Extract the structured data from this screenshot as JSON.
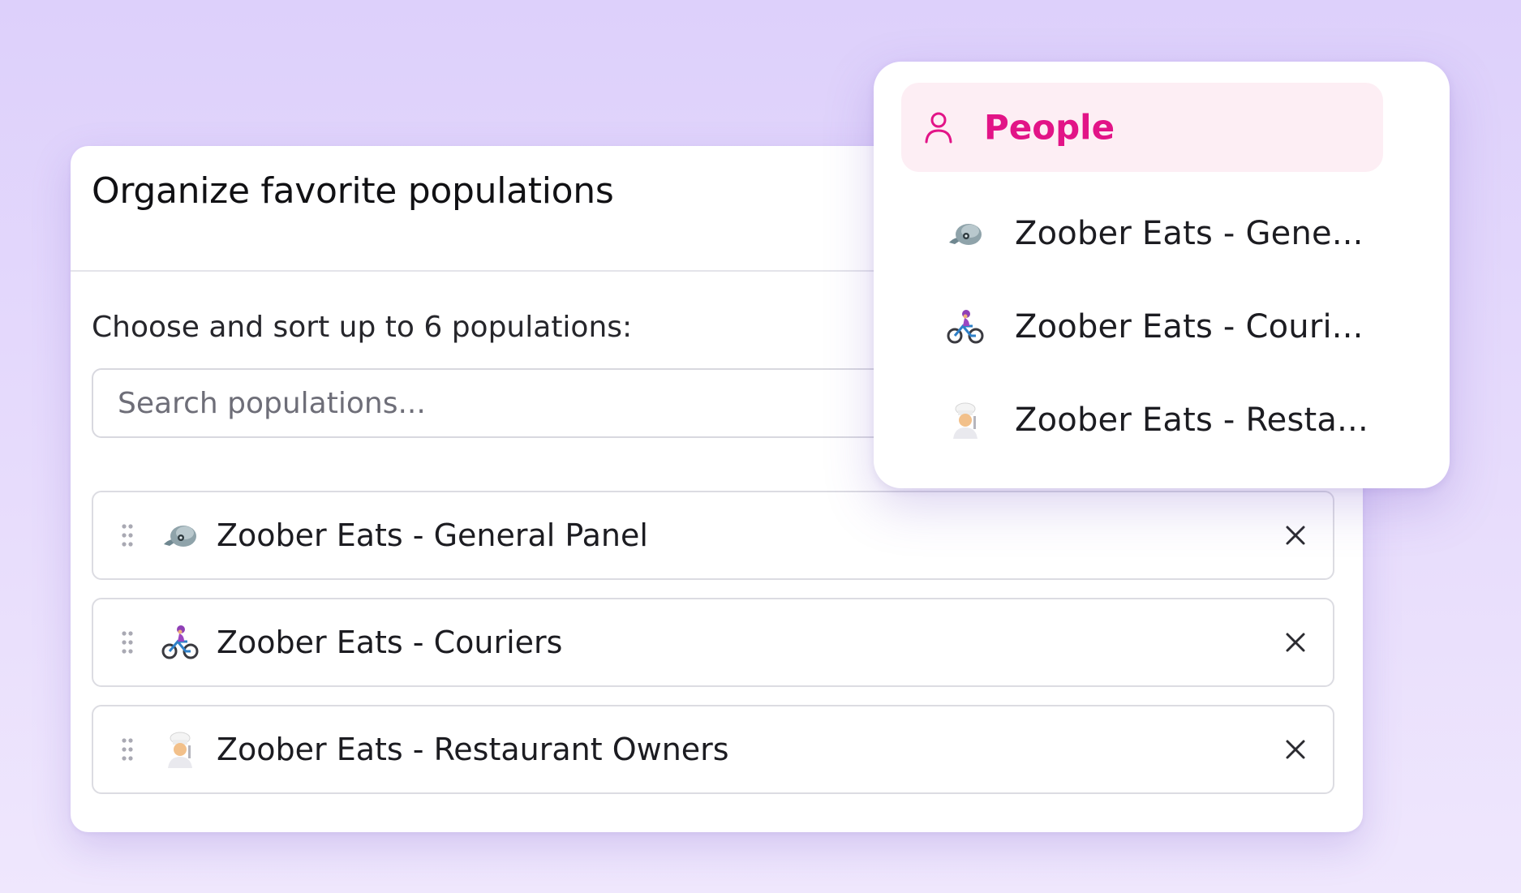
{
  "card": {
    "title": "Organize favorite populations",
    "instructions": "Choose and sort up to 6 populations:",
    "search": {
      "placeholder": "Search populations...",
      "value": ""
    },
    "populations": [
      {
        "label": "Zoober Eats - General Panel",
        "icon": "cap-emoji-icon"
      },
      {
        "label": "Zoober Eats - Couriers",
        "icon": "cyclist-emoji-icon"
      },
      {
        "label": "Zoober Eats - Restaurant Owners",
        "icon": "chef-emoji-icon"
      }
    ]
  },
  "dropdown": {
    "header": {
      "label": "People",
      "icon": "person-icon",
      "color": "#e21487"
    },
    "items": [
      {
        "label": "Zoober Eats - Gene...",
        "icon": "cap-emoji-icon"
      },
      {
        "label": "Zoober Eats - Couri...",
        "icon": "cyclist-emoji-icon"
      },
      {
        "label": "Zoober Eats - Resta...",
        "icon": "chef-emoji-icon"
      }
    ]
  }
}
